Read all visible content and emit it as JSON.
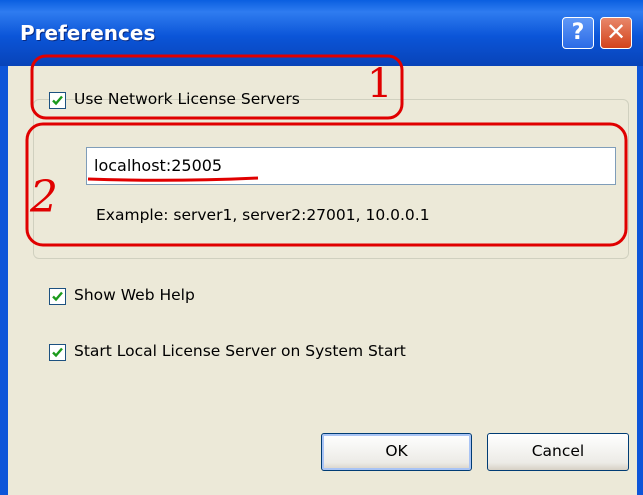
{
  "window": {
    "title": "Preferences",
    "help_glyph": "?",
    "close_glyph": "✕"
  },
  "network": {
    "checkbox_label": "Use Network License Servers",
    "checked": true
  },
  "server_input": {
    "value": "localhost:25005"
  },
  "example_text": "Example: server1, server2:27001, 10.0.0.1",
  "options": [
    {
      "label": "Show Web Help",
      "checked": true
    },
    {
      "label": "Start Local License Server on System Start",
      "checked": true
    }
  ],
  "buttons": {
    "ok": "OK",
    "cancel": "Cancel"
  },
  "annotations": {
    "marker_1": "1",
    "marker_2": "2",
    "color": "#e00000"
  },
  "colors": {
    "titlebar": "#0a55d8",
    "dialog_bg": "#ece9d8",
    "check": "#1c9a1c"
  }
}
